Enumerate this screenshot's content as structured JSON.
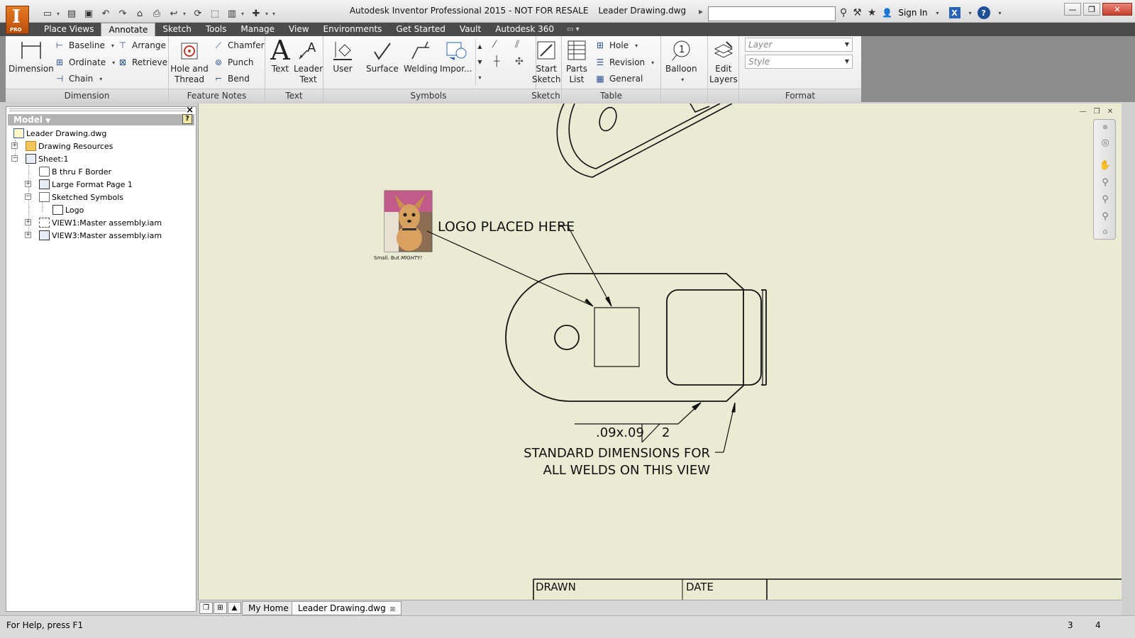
{
  "window": {
    "app_badge": "I",
    "app_badge_sub": "PRO",
    "title": "Autodesk Inventor Professional 2015 - NOT FOR RESALE",
    "file": "Leader Drawing.dwg",
    "sign_in": "Sign In"
  },
  "tabs": [
    "Place Views",
    "Annotate",
    "Sketch",
    "Tools",
    "Manage",
    "View",
    "Environments",
    "Get Started",
    "Vault",
    "Autodesk 360"
  ],
  "ribbon": {
    "dimension": {
      "title": "Dimension",
      "dimension": "Dimension",
      "baseline": "Baseline",
      "ordinate": "Ordinate",
      "chain": "Chain",
      "arrange": "Arrange",
      "retrieve": "Retrieve"
    },
    "feature_notes": {
      "title": "Feature Notes",
      "hole_thread_1": "Hole and",
      "hole_thread_2": "Thread",
      "chamfer": "Chamfer",
      "punch": "Punch",
      "bend": "Bend"
    },
    "text": {
      "title": "Text",
      "text": "Text",
      "leader_1": "Leader",
      "leader_2": "Text"
    },
    "symbols": {
      "title": "Symbols",
      "user": "User",
      "surface": "Surface",
      "welding": "Welding",
      "import": "Impor..."
    },
    "sketch": {
      "title": "Sketch",
      "start_1": "Start",
      "start_2": "Sketch"
    },
    "table": {
      "title": "Table",
      "parts_1": "Parts",
      "parts_2": "List",
      "hole": "Hole",
      "revision": "Revision",
      "general": "General"
    },
    "balloon": {
      "label": "Balloon",
      "number": "1"
    },
    "layers": {
      "label_1": "Edit",
      "label_2": "Layers"
    },
    "format": {
      "title": "Format",
      "layer_placeholder": "Layer",
      "style_placeholder": "Style"
    }
  },
  "browser": {
    "title": "Model",
    "help": "?",
    "items": [
      {
        "label": "Leader Drawing.dwg"
      },
      {
        "label": "Drawing Resources"
      },
      {
        "label": "Sheet:1"
      },
      {
        "label": "B thru F Border"
      },
      {
        "label": "Large Format Page 1"
      },
      {
        "label": "Sketched Symbols"
      },
      {
        "label": "Logo"
      },
      {
        "label": "VIEW1:Master assembly.iam"
      },
      {
        "label": "VIEW3:Master assembly.iam"
      }
    ]
  },
  "drawing": {
    "logo_caption_a": "Small.  But ",
    "logo_caption_b": "MIGHTY!",
    "logo_note": "LOGO PLACED HERE",
    "weld_size": ".09x.09",
    "weld_count": "2",
    "weld_note_1": "STANDARD DIMENSIONS FOR",
    "weld_note_2": "ALL WELDS ON THIS VIEW",
    "title_block_1": "DRAWN",
    "title_block_2": "DATE"
  },
  "doc_tabs": {
    "home": "My Home",
    "file": "Leader Drawing.dwg"
  },
  "status": {
    "message": "For Help, press F1",
    "n1": "3",
    "n2": "4"
  },
  "colors": {
    "canvas": "#ebead3",
    "tab_bar": "#4b4b4b",
    "app_orange": "#d4661a"
  }
}
